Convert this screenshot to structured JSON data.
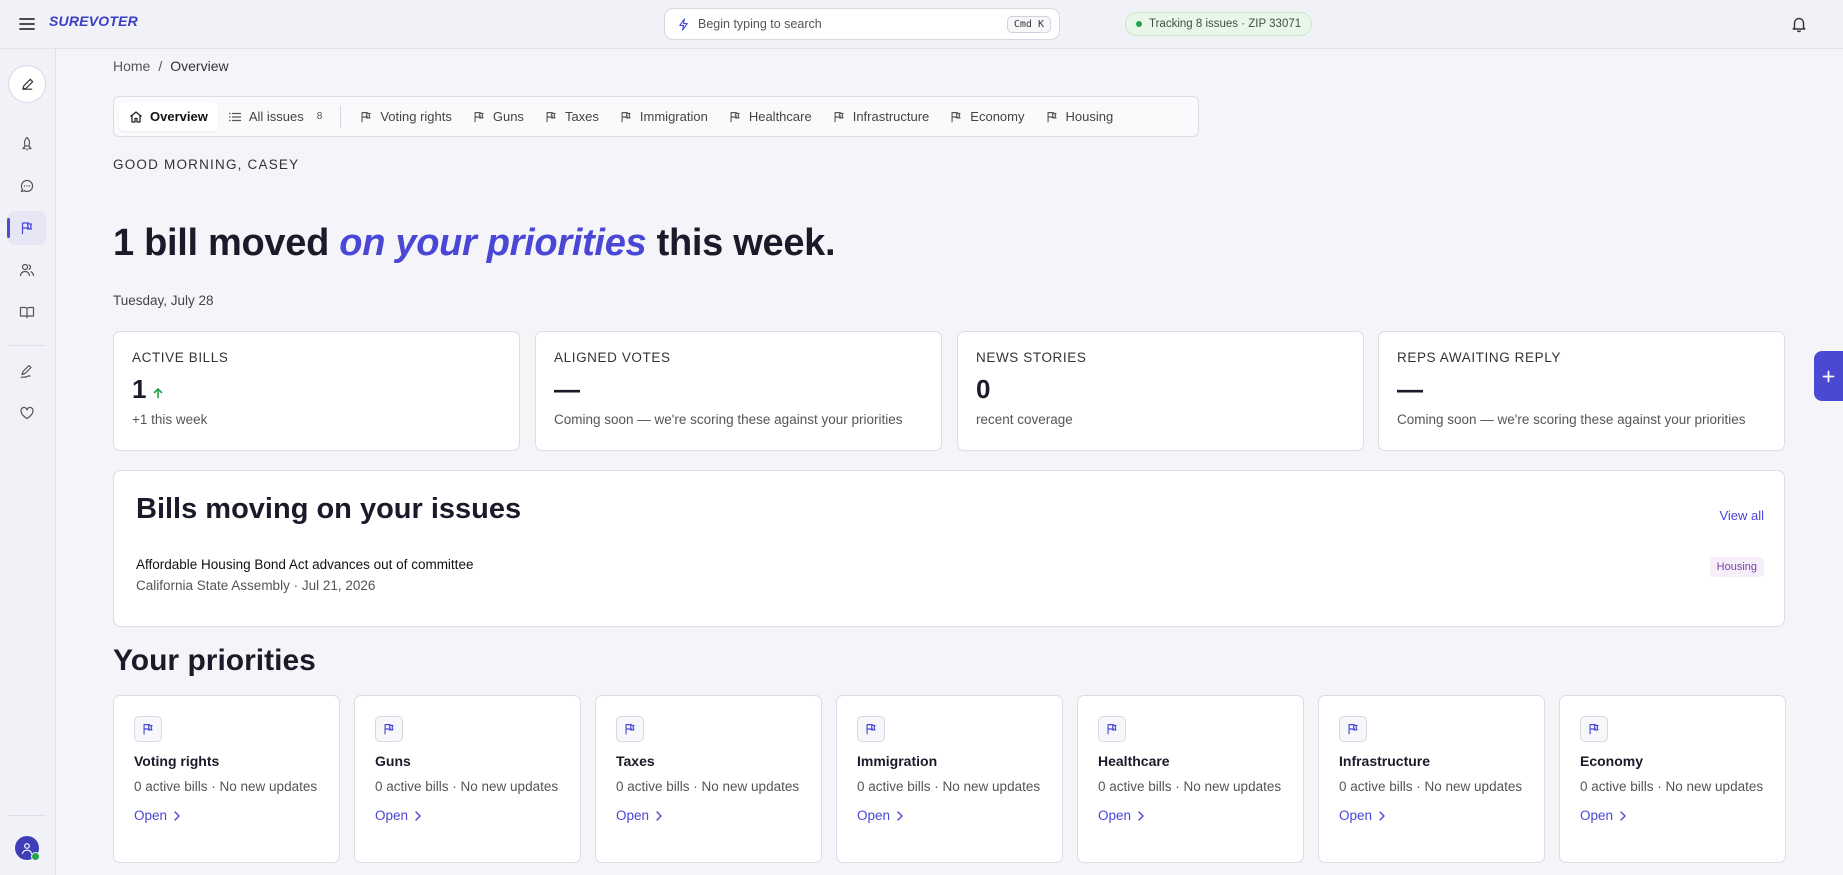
{
  "topbar": {
    "logo": "SUREVOTER",
    "search_placeholder": "Begin typing to search",
    "search_shortcut": "Cmd K",
    "tracking": "Tracking 8 issues · ZIP 33071"
  },
  "breadcrumb": {
    "home": "Home",
    "current": "Overview"
  },
  "tabs": [
    {
      "label": "Overview",
      "icon": "home-icon"
    },
    {
      "label": "All issues",
      "icon": "list-icon",
      "count": "8"
    },
    {
      "label": "Voting rights",
      "icon": "flag-icon"
    },
    {
      "label": "Guns",
      "icon": "flag-icon"
    },
    {
      "label": "Taxes",
      "icon": "flag-icon"
    },
    {
      "label": "Immigration",
      "icon": "flag-icon"
    },
    {
      "label": "Healthcare",
      "icon": "flag-icon"
    },
    {
      "label": "Infrastructure",
      "icon": "flag-icon"
    },
    {
      "label": "Economy",
      "icon": "flag-icon"
    },
    {
      "label": "Housing",
      "icon": "flag-icon"
    }
  ],
  "greeting": "GOOD MORNING, CASEY",
  "headline": {
    "before": "1 bill moved ",
    "highlight": "on your priorities",
    "after": " this week."
  },
  "date": "Tuesday, July 28",
  "stats": [
    {
      "label": "ACTIVE BILLS",
      "value": "1",
      "sub": "+1 this week",
      "trend": "up"
    },
    {
      "label": "ALIGNED VOTES",
      "value": "—",
      "sub": "Coming soon — we're scoring these against your priorities"
    },
    {
      "label": "NEWS STORIES",
      "value": "0",
      "sub": "recent coverage"
    },
    {
      "label": "REPS AWAITING REPLY",
      "value": "—",
      "sub": "Coming soon — we're scoring these against your priorities"
    }
  ],
  "bills": {
    "title": "Bills moving on your issues",
    "view_all": "View all",
    "items": [
      {
        "title": "Affordable Housing Bond Act advances out of committee",
        "meta": "California State Assembly · Jul 21, 2026",
        "tag": "Housing"
      }
    ]
  },
  "priorities": {
    "title": "Your priorities",
    "items": [
      {
        "name": "Voting rights",
        "sub": "0 active bills · No new updates",
        "open": "Open"
      },
      {
        "name": "Guns",
        "sub": "0 active bills · No new updates",
        "open": "Open"
      },
      {
        "name": "Taxes",
        "sub": "0 active bills · No new updates",
        "open": "Open"
      },
      {
        "name": "Immigration",
        "sub": "0 active bills · No new updates",
        "open": "Open"
      },
      {
        "name": "Healthcare",
        "sub": "0 active bills · No new updates",
        "open": "Open"
      },
      {
        "name": "Infrastructure",
        "sub": "0 active bills · No new updates",
        "open": "Open"
      },
      {
        "name": "Economy",
        "sub": "0 active bills · No new updates",
        "open": "Open"
      }
    ]
  },
  "colors": {
    "accent": "#4a46d6",
    "success": "#22a447",
    "tag": "#7b3fa8"
  }
}
